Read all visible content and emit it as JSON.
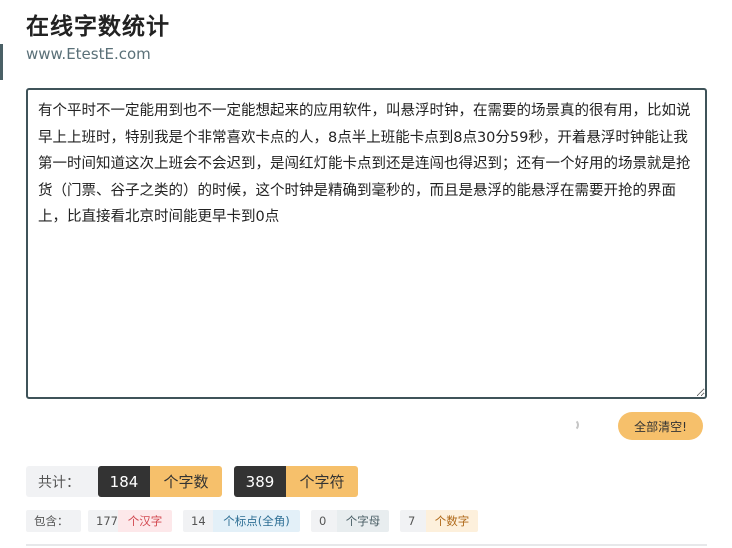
{
  "header": {
    "title": "在线字数统计",
    "site": "www.EtestE.com"
  },
  "editor": {
    "text": "有个平时不一定能用到也不一定能想起来的应用软件，叫悬浮时钟，在需要的场景真的很有用，比如说早上上班时，特别我是个非常喜欢卡点的人，8点半上班能卡点到8点30分59秒，开着悬浮时钟能让我第一时间知道这次上班会不会迟到，是闯红灯能卡点到还是连闯也得迟到；还有一个好用的场景就是抢货（门票、谷子之类的）的时候，这个时钟是精确到毫秒的，而且是悬浮的能悬浮在需要开抢的界面上，比直接看北京时间能更早卡到0点"
  },
  "actions": {
    "clear_label": "全部清空!"
  },
  "totals": {
    "label": "共计：",
    "chars_count": "184",
    "chars_unit": "个字数",
    "symbols_count": "389",
    "symbols_unit": "个字符"
  },
  "detail": {
    "label": "包含：",
    "items": [
      {
        "count": "177",
        "unit": "个汉字",
        "color": "#d2474f",
        "bg": "#fde8ea"
      },
      {
        "count": "14",
        "unit": "个标点(全角)",
        "color": "#2e6f95",
        "bg": "#e3f0f8"
      },
      {
        "count": "0",
        "unit": "个字母",
        "color": "#4a5f66",
        "bg": "#e8edef"
      },
      {
        "count": "7",
        "unit": "个数字",
        "color": "#b06a1a",
        "bg": "#fdf0dc"
      }
    ]
  },
  "colors": {
    "accent": "#f6c06b",
    "dark": "#333333",
    "border": "#3f5359"
  }
}
